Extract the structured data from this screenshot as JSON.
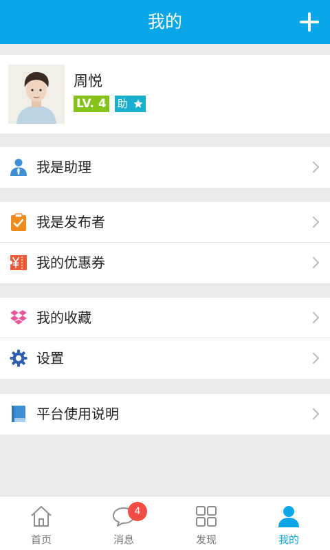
{
  "header": {
    "title": "我的"
  },
  "profile": {
    "name": "周悦",
    "level": "LV. 4",
    "role_badge": "助"
  },
  "menu": {
    "assistant": "我是助理",
    "publisher": "我是发布者",
    "coupons": "我的优惠券",
    "favorites": "我的收藏",
    "settings": "设置",
    "guide": "平台使用说明"
  },
  "tabbar": {
    "home": "首页",
    "messages": "消息",
    "messages_badge": "4",
    "discover": "发现",
    "mine": "我的"
  },
  "colors": {
    "header": "#0aa7e8",
    "level_badge": "#85c21a",
    "role_badge": "#19b0cf",
    "notify_badge": "#f14c44"
  }
}
